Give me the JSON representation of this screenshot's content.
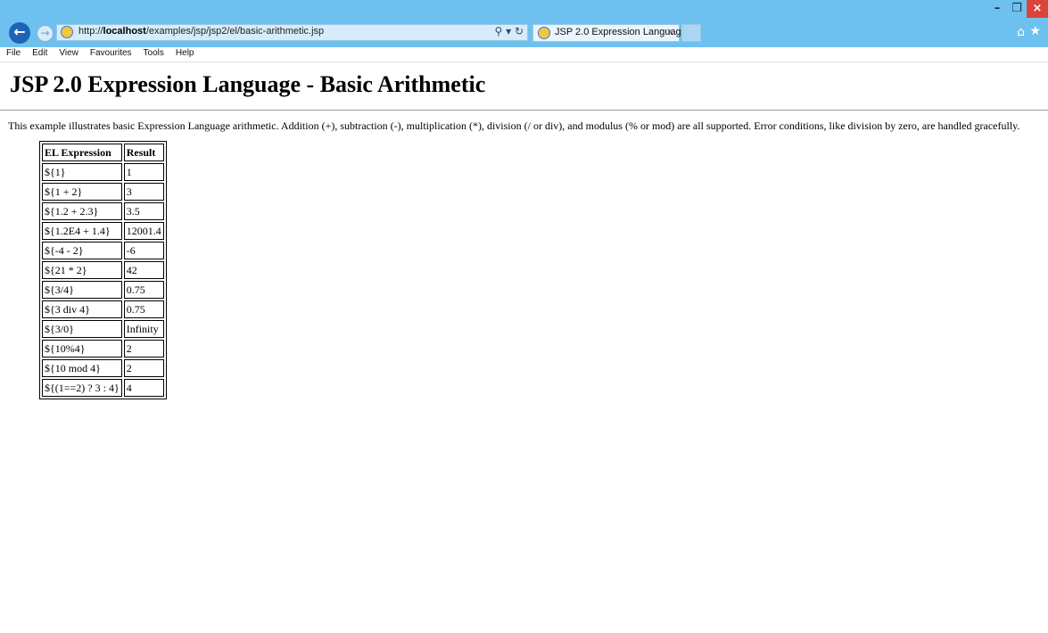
{
  "browser": {
    "url_prefix": "http://",
    "url_host": "localhost",
    "url_path": "/examples/jsp/jsp2/el/basic-arithmetic.jsp",
    "tab_title": "JSP 2.0 Expression Languag...",
    "search_icon": "search-icon",
    "refresh_icon": "refresh-icon"
  },
  "menu": {
    "items": [
      "File",
      "Edit",
      "View",
      "Favourites",
      "Tools",
      "Help"
    ]
  },
  "page": {
    "title": "JSP 2.0 Expression Language - Basic Arithmetic",
    "description": "This example illustrates basic Expression Language arithmetic. Addition (+), subtraction (-), multiplication (*), division (/ or div), and modulus (% or mod) are all supported. Error conditions, like division by zero, are handled gracefully.",
    "table": {
      "headers": [
        "EL Expression",
        "Result"
      ],
      "rows": [
        [
          "${1}",
          "1"
        ],
        [
          "${1 + 2}",
          "3"
        ],
        [
          "${1.2 + 2.3}",
          "3.5"
        ],
        [
          "${1.2E4 + 1.4}",
          "12001.4"
        ],
        [
          "${-4 - 2}",
          "-6"
        ],
        [
          "${21 * 2}",
          "42"
        ],
        [
          "${3/4}",
          "0.75"
        ],
        [
          "${3 div 4}",
          "0.75"
        ],
        [
          "${3/0}",
          "Infinity"
        ],
        [
          "${10%4}",
          "2"
        ],
        [
          "${10 mod 4}",
          "2"
        ],
        [
          "${(1==2) ? 3 : 4}",
          "4"
        ]
      ]
    }
  }
}
